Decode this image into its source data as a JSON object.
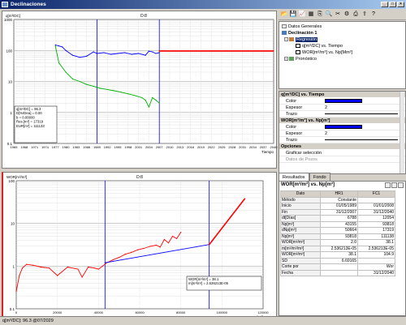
{
  "window": {
    "title": "Declinaciones",
    "buttons": [
      "_",
      "□",
      "×"
    ]
  },
  "chart_data": [
    {
      "type": "line",
      "title": "D:8",
      "ylabel": "q[m³/DC]",
      "xlabel": "Tiempo",
      "yscale": "log",
      "yticks": [
        "1000",
        "100",
        "10",
        "1",
        "0.1"
      ],
      "ylim": [
        0.1,
        1000
      ],
      "xlim": [
        1965,
        2040
      ],
      "x_ticks": [
        "1965",
        "1968",
        "1971",
        "1974",
        "1977",
        "1980",
        "1983",
        "1986",
        "1989",
        "1992",
        "1995",
        "1998",
        "2001",
        "2004",
        "2007",
        "2010",
        "2013",
        "2016",
        "2019",
        "2022",
        "2025",
        "2028",
        "2031",
        "2034",
        "2037",
        "2040"
      ],
      "vertical_markers": [
        1989,
        2007
      ],
      "series": [
        {
          "name": "q[m³/DC]",
          "color": "#0000ff",
          "x": [
            1977,
            1978,
            1979,
            1980,
            1982,
            1984,
            1986,
            1988,
            1989,
            1991,
            1993,
            1995,
            1997,
            1999,
            2001,
            2003,
            2004,
            2005,
            2006,
            2007
          ],
          "y": [
            150,
            140,
            130,
            100,
            70,
            60,
            65,
            90,
            80,
            85,
            75,
            80,
            85,
            75,
            80,
            70,
            95,
            90,
            80,
            85
          ]
        },
        {
          "name": "WOR",
          "color": "#00b000",
          "x": [
            1977,
            1978,
            1980,
            1982,
            1984,
            1986,
            1988,
            1990,
            1992,
            1994,
            1996,
            1998,
            2000,
            2002,
            2003,
            2004,
            2005,
            2006,
            2007
          ],
          "y": [
            140,
            40,
            20,
            12,
            10,
            8,
            7,
            6,
            5.5,
            5,
            4.5,
            4,
            3.5,
            3,
            2.5,
            1.5,
            3,
            2.5,
            2
          ]
        },
        {
          "name": "Pronóstico",
          "color": "#ff0000",
          "x": [
            2007,
            2040
          ],
          "y": [
            96.3,
            96.3
          ]
        }
      ],
      "legend": {
        "lines": [
          "q[m³/DC] = 96.3",
          "D[%/Dea] = 0.00",
          "b              = 0.00000",
          "Res.[m³]    = 17319",
          "EUR[m³]     = 111133"
        ]
      }
    },
    {
      "type": "line",
      "title": "D:8",
      "ylabel": "WOR[m³/m³]",
      "xlabel": "Np[m³]",
      "yscale": "log",
      "yticks": [
        "100",
        "10",
        "1",
        "0.1"
      ],
      "ylim": [
        0.1,
        100
      ],
      "xlim": [
        0,
        120000
      ],
      "x_ticks": [
        "0",
        "20000",
        "40000",
        "60000",
        "80000",
        "100000",
        "120000"
      ],
      "vertical_markers": [
        43155,
        93818
      ],
      "series": [
        {
          "name": "WOR",
          "color": "#ff0000",
          "x": [
            0,
            1500,
            3000,
            5000,
            8000,
            12000,
            16000,
            20000,
            25000,
            30000,
            32000,
            35000,
            38000,
            40000,
            42000,
            44000,
            47000,
            50000,
            53000,
            56000,
            59000,
            62000,
            65000,
            68000,
            70000,
            72000,
            74000,
            76000,
            78000,
            80000
          ],
          "y": [
            0.25,
            0.6,
            0.9,
            1.1,
            1.05,
            0.95,
            0.9,
            0.6,
            0.95,
            0.85,
            0.55,
            0.95,
            0.9,
            0.85,
            1.0,
            1.2,
            1.4,
            1.6,
            1.9,
            2.1,
            2.4,
            2.6,
            2.9,
            3.1,
            2.8,
            4.2,
            3.5,
            5.0,
            4.4,
            6.2
          ]
        },
        {
          "name": "Ajuste",
          "color": "#0000ff",
          "x": [
            43155,
            93818
          ],
          "y": [
            1.2,
            3.2
          ]
        },
        {
          "name": "Pronóstico",
          "color": "#ff0000",
          "x": [
            93818,
            111133
          ],
          "y": [
            3.2,
            38.1
          ]
        }
      ],
      "legend": {
        "lines": [
          "WOR[m³/m³] = 38.1",
          "m[m³/m³]     = 2.536213E-05"
        ]
      }
    }
  ],
  "sidebar": {
    "tree": [
      {
        "label": "Datos Generales",
        "level": 0,
        "selected": false
      },
      {
        "label": "Declinación 1",
        "level": 0,
        "selected": false,
        "bold": true
      },
      {
        "label": "Regresión",
        "level": 1,
        "selected": true
      },
      {
        "label": "q[m³/DC] vs. Tiempo",
        "level": 2,
        "selected": false
      },
      {
        "label": "WOR[m³/m³] vs. Np[Mm³]",
        "level": 2,
        "selected": false
      },
      {
        "label": "Pronóstico",
        "level": 1,
        "selected": false
      }
    ],
    "props": [
      {
        "header": "q[m³/DC] vs. Tiempo",
        "rows": [
          {
            "key": "Color",
            "value": "",
            "color": "#0000ff"
          },
          {
            "key": "Espesor",
            "value": "2"
          },
          {
            "key": "Trazo",
            "value": ""
          }
        ]
      },
      {
        "header": "WOR[m³/m³] vs. Np[m³]",
        "rows": [
          {
            "key": "Color",
            "value": "",
            "color": "#0000ff"
          },
          {
            "key": "Espesor",
            "value": "2"
          },
          {
            "key": "Trazo",
            "value": ""
          }
        ]
      },
      {
        "header": "Opciones",
        "rows": [
          {
            "key": "Graficar selección",
            "value": ""
          },
          {
            "key": "Datos de Pozos",
            "value": "",
            "disabled": true
          }
        ]
      }
    ],
    "tabs": [
      "Resultados",
      "Fondo"
    ],
    "results": {
      "title": "WOR[m³/m³] vs. Np[m³]",
      "headers": [
        "Dato",
        "HR1",
        "FC1"
      ],
      "rows": [
        [
          "Método",
          "Constante",
          ""
        ],
        [
          "Inicio",
          "01/05/1989",
          "01/01/2008"
        ],
        [
          "Fin",
          "31/12/2007",
          "31/12/2040"
        ],
        [
          "dt[Días]",
          "6788",
          "12054"
        ],
        [
          "Np[m³]",
          "43155",
          "93818"
        ],
        [
          "dNp[m³]",
          "50664",
          "17319"
        ],
        [
          "Np[m³]",
          "93818",
          "111138"
        ],
        [
          "WOR[m³/m³]",
          "2.0",
          "38.1"
        ],
        [
          "m[m³/m³/m³]",
          "2.536213E-05",
          "2.536213E-05"
        ],
        [
          "WOR[m³/m³]",
          "38.1",
          "104.9"
        ],
        [
          "SD",
          "6.69165",
          ""
        ],
        [
          "Corte por",
          "",
          "Wor"
        ],
        [
          "Fecha",
          "",
          "31/12/2040"
        ]
      ]
    }
  },
  "status": {
    "text": "q[m³/DC]: 96.3 @07/2029"
  },
  "colors": {
    "titlebar": "#0a246a",
    "accent_red": "#ff0000",
    "accent_blue": "#0000ff",
    "accent_green": "#00b000"
  }
}
